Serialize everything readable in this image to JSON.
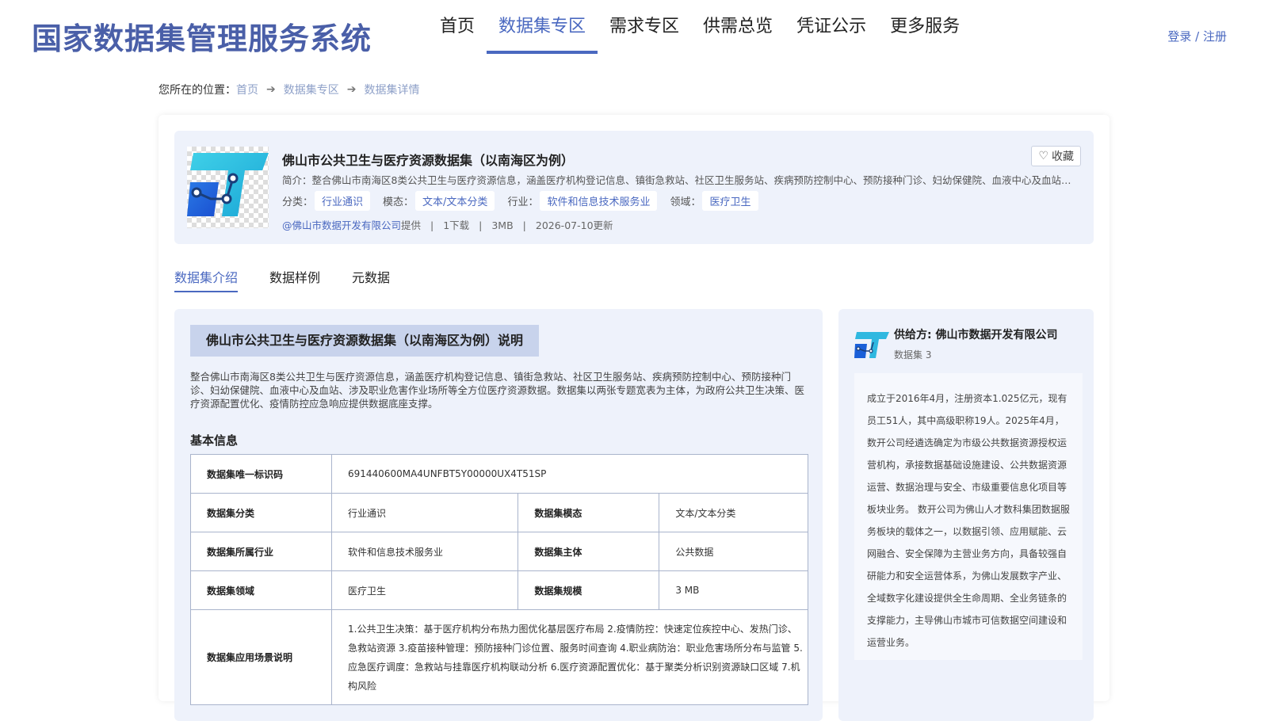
{
  "header": {
    "logo": "国家数据集管理服务系统",
    "nav": [
      "首页",
      "数据集专区",
      "需求专区",
      "供需总览",
      "凭证公示",
      "更多服务"
    ],
    "active_nav": 1,
    "login": "登录 / 注册"
  },
  "breadcrumb": {
    "label": "您所在的位置：",
    "items": [
      "首页",
      "数据集专区",
      "数据集详情"
    ]
  },
  "dataset": {
    "title": "佛山市公共卫生与医疗资源数据集（以南海区为例）",
    "brief": "简介：整合佛山市南海区8类公共卫生与医疗资源信息，涵盖医疗机构登记信息、镇街急救站、社区卫生服务站、疾病预防控制中心、预防接种门诊、妇幼保健院、血液中心及血站、涉及职业危害作业场所等全方位医疗资源数据。",
    "tags": [
      {
        "label": "分类：",
        "value": "行业通识"
      },
      {
        "label": "模态：",
        "value": "文本/文本分类"
      },
      {
        "label": "行业：",
        "value": "软件和信息技术服务业"
      },
      {
        "label": "领域：",
        "value": "医疗卫生"
      }
    ],
    "provider": "@佛山市数据开发有限公司",
    "provide_suffix": "提供",
    "downloads": "1下载",
    "size": "3MB",
    "updated": "2026-07-10更新",
    "favorite": "收藏"
  },
  "tabs": [
    "数据集介绍",
    "数据样例",
    "元数据"
  ],
  "active_tab": 0,
  "intro": {
    "section_title": "佛山市公共卫生与医疗资源数据集（以南海区为例）说明",
    "description": "整合佛山市南海区8类公共卫生与医疗资源信息，涵盖医疗机构登记信息、镇街急救站、社区卫生服务站、疾病预防控制中心、预防接种门诊、妇幼保健院、血液中心及血站、涉及职业危害作业场所等全方位医疗资源数据。数据集以两张专题宽表为主体，为政府公共卫生决策、医疗资源配置优化、疫情防控应急响应提供数据底座支撑。",
    "basic_title": "基本信息",
    "table": {
      "id_label": "数据集唯一标识码",
      "id_value": "691440600MA4UNFBT5Y00000UX4T51SP",
      "category_label": "数据集分类",
      "category_value": "行业通识",
      "modality_label": "数据集模态",
      "modality_value": "文本/文本分类",
      "industry_label": "数据集所属行业",
      "industry_value": "软件和信息技术服务业",
      "subject_label": "数据集主体",
      "subject_value": "公共数据",
      "domain_label": "数据集领域",
      "domain_value": "医疗卫生",
      "scale_label": "数据集规模",
      "scale_value": "3 MB",
      "scenario_label": "数据集应用场景说明",
      "scenario_value": "1.公共卫生决策：基于医疗机构分布热力图优化基层医疗布局 2.疫情防控：快速定位疾控中心、发热门诊、急救站资源 3.疫苗接种管理：预防接种门诊位置、服务时间查询 4.职业病防治：职业危害场所分布与监管 5.应急医疗调度：急救站与挂靠医疗机构联动分析 6.医疗资源配置优化：基于聚类分析识别资源缺口区域 7.机构风险"
    }
  },
  "provider_panel": {
    "name": "供给方: 佛山市数据开发有限公司",
    "count": "数据集 3",
    "description": "成立于2016年4月，注册资本1.025亿元，现有员工51人，其中高级职称19人。2025年4月，数开公司经遴选确定为市级公共数据资源授权运营机构，承接数据基础设施建设、公共数据资源运营、数据治理与安全、市级重要信息化项目等板块业务。 数开公司为佛山人才数科集团数据服务板块的载体之一，以数据引领、应用赋能、云网融合、安全保障为主营业务方向，具备较强自研能力和安全运营体系，为佛山发展数字产业、全域数字化建设提供全生命周期、全业务链条的支撑能力，主导佛山市城市可信数据空间建设和运营业务。"
  },
  "colors": {
    "brand": "#4a5fa8",
    "accent": "#4a68c0",
    "panel": "#eef2fb"
  },
  "icons": {
    "arrow": "arrow-right-icon",
    "favorite": "heart-icon",
    "logo": "dataset-logo-icon"
  }
}
